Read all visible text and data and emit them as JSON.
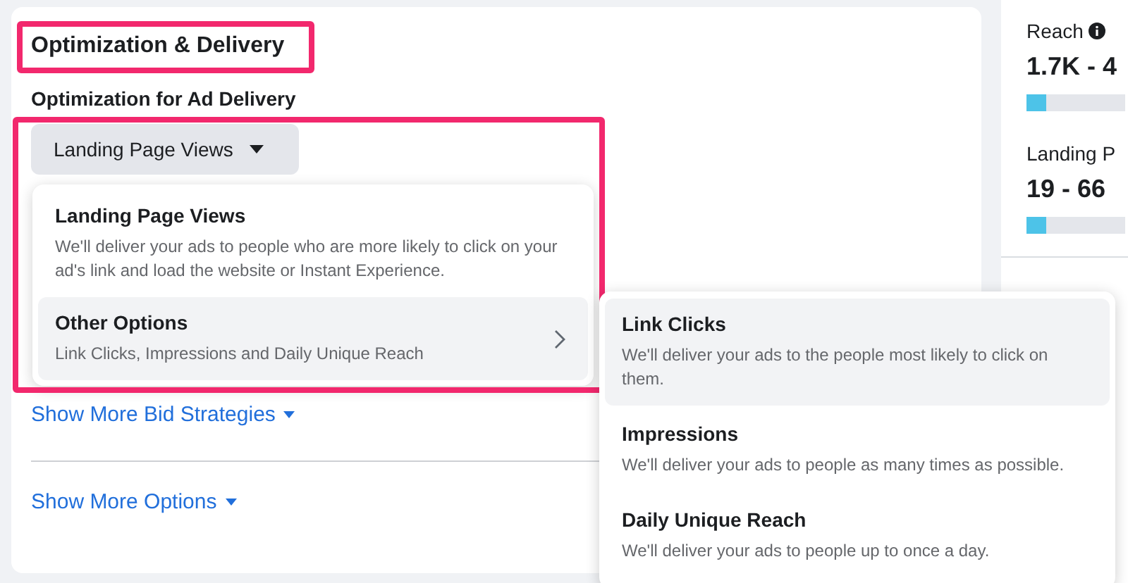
{
  "section": {
    "title": "Optimization & Delivery",
    "field_label": "Optimization for Ad Delivery",
    "dropdown": {
      "value": "Landing Page Views",
      "expanded": true
    }
  },
  "dropdown_menu": [
    {
      "title": "Landing Page Views",
      "description": "We'll deliver your ads to people who are more likely to click on your ad's link and load the website or Instant Experience.",
      "selected": false,
      "has_submenu": false
    },
    {
      "title": "Other Options",
      "description": "Link Clicks, Impressions and Daily Unique Reach",
      "selected": true,
      "has_submenu": true
    }
  ],
  "submenu": [
    {
      "title": "Link Clicks",
      "description": "We'll deliver your ads to the people most likely to click on them.",
      "selected": true
    },
    {
      "title": "Impressions",
      "description": "We'll deliver your ads to people as many times as possible.",
      "selected": false
    },
    {
      "title": "Daily Unique Reach",
      "description": "We'll deliver your ads to people up to once a day.",
      "selected": false
    }
  ],
  "links": [
    "Show More Bid Strategies",
    "Show More Options"
  ],
  "estimates": [
    {
      "label": "Reach",
      "info": true,
      "value": "1.7K - 4",
      "level": 0.2
    },
    {
      "label": "Landing P",
      "info": false,
      "value": "19 - 66",
      "level": 0.2
    }
  ]
}
